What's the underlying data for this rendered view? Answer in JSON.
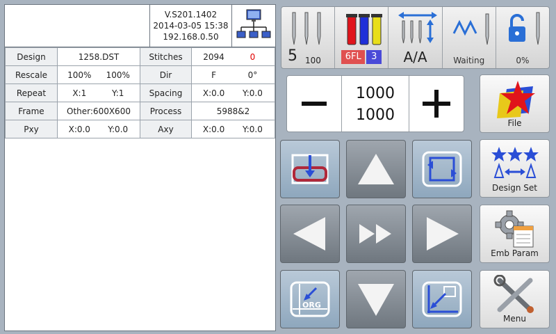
{
  "header": {
    "version": "V.S201.1402",
    "datetime": "2014-03-05 15:38",
    "ip": "192.168.0.50"
  },
  "info": {
    "design_label": "Design",
    "design_value": "1258.DST",
    "stitches_label": "Stitches",
    "stitches_value": "2094",
    "stitches_extra": "0",
    "rescale_label": "Rescale",
    "rescale_x": "100%",
    "rescale_y": "100%",
    "dir_label": "Dir",
    "dir_value": "F",
    "dir_angle": "0°",
    "repeat_label": "Repeat",
    "repeat_x": "X:1",
    "repeat_y": "Y:1",
    "spacing_label": "Spacing",
    "spacing_x": "X:0.0",
    "spacing_y": "Y:0.0",
    "frame_label": "Frame",
    "frame_value": "Other:600X600",
    "process_label": "Process",
    "process_value": "5988&2",
    "pxy_label": "Pxy",
    "pxy_x": "X:0.0",
    "pxy_y": "Y:0.0",
    "axy_label": "Axy",
    "axy_x": "X:0.0",
    "axy_y": "Y:0.0"
  },
  "status": {
    "needle_num": "5",
    "speed": "100",
    "color_code": "6FL",
    "color_index": "3",
    "mode": "A/A",
    "state": "Waiting",
    "progress": "0%"
  },
  "counter": {
    "value_top": "1000",
    "value_bottom": "1000"
  },
  "sidebar": {
    "file": "File",
    "design_set": "Design Set",
    "emb_param": "Emb Param",
    "menu": "Menu"
  },
  "colors": {
    "thread_red": "#e0141b",
    "thread_blue": "#1f2fd8",
    "thread_yellow": "#e8de1a",
    "icon_blue": "#2a4ed6"
  },
  "icons": {
    "network": "network-icon",
    "needles": "needles-icon",
    "threads": "thread-spools-icon",
    "needle_shift": "needle-shift-icon",
    "zigzag": "zigzag-stitch-icon",
    "lock": "unlock-icon"
  }
}
